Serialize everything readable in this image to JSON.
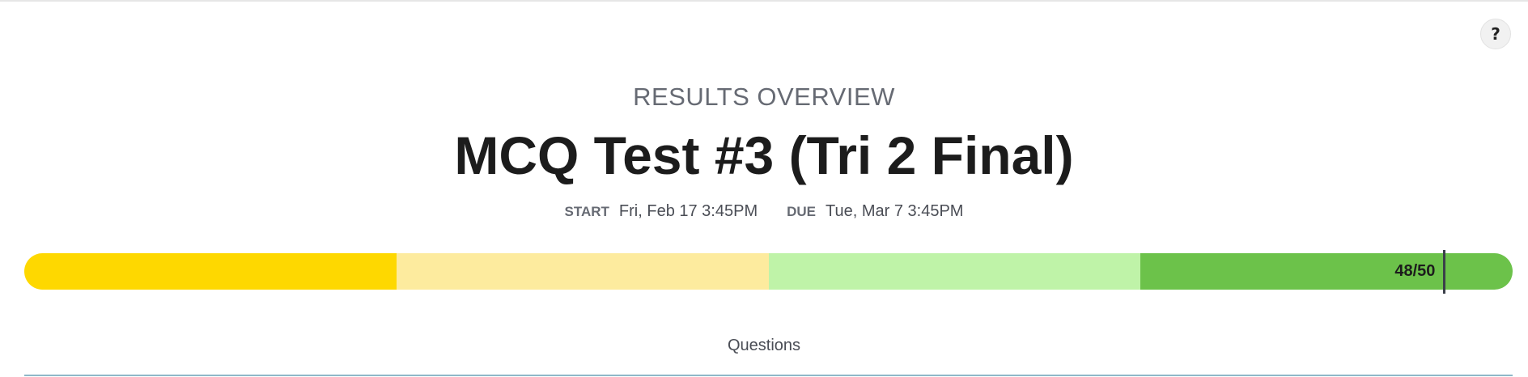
{
  "help": {
    "icon": "help-icon",
    "label": "?"
  },
  "header": {
    "eyebrow": "RESULTS OVERVIEW",
    "title": "MCQ Test #3 (Tri 2 Final)",
    "start_label": "START",
    "start_value": "Fri, Feb 17 3:45PM",
    "due_label": "DUE",
    "due_value": "Tue, Mar 7 3:45PM"
  },
  "score_bar": {
    "score_text": "48/50",
    "score": 48,
    "max": 50,
    "bands": [
      {
        "color": "#fed800"
      },
      {
        "color": "#fdeb9e"
      },
      {
        "color": "#bff3a8"
      },
      {
        "color": "#6cc24a"
      }
    ]
  },
  "tabs": {
    "questions_label": "Questions"
  }
}
